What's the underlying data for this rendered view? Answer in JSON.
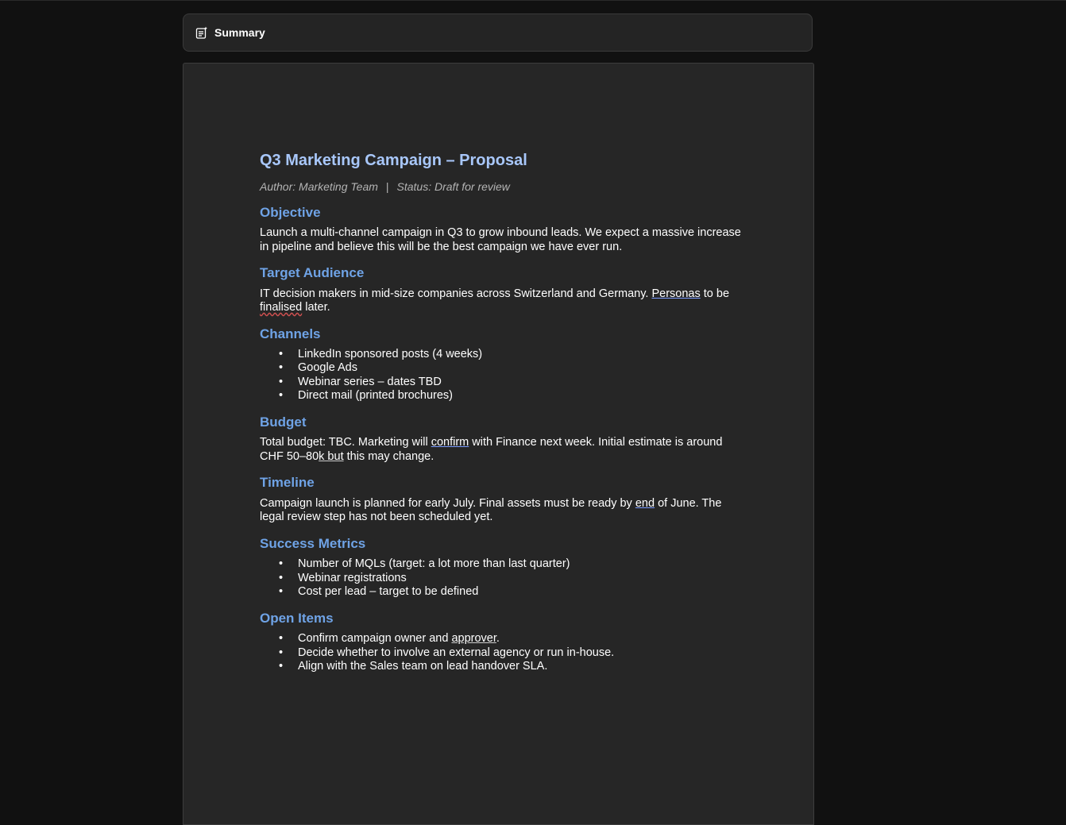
{
  "summary": {
    "label": "Summary",
    "icon": "summary-sparkle-icon"
  },
  "document": {
    "title": "Q3 Marketing Campaign – Proposal",
    "author": "Author: Marketing Team",
    "separator": "|",
    "status": "Status: Draft for review",
    "objective": {
      "heading": "Objective",
      "text": "Launch a multi-channel campaign in Q3 to grow inbound leads. We expect a massive increase in pipeline and believe this will be the best campaign we have ever run."
    },
    "target_audience": {
      "heading": "Target Audience",
      "text_before": "IT decision makers in mid-size companies across Switzerland and Germany. ",
      "personas": "Personas",
      "text_mid": " to be ",
      "finalised": "finalised",
      "text_after": " later."
    },
    "channels": {
      "heading": "Channels",
      "items": [
        "LinkedIn sponsored posts (4 weeks)",
        "Google Ads",
        "Webinar series – dates TBD",
        "Direct mail (printed brochures)"
      ]
    },
    "budget": {
      "heading": "Budget",
      "text_before": "Total budget: TBC. Marketing will ",
      "confirm": "confirm",
      "text_mid": " with Finance next week. Initial estimate is around CHF 50–80",
      "k_but": "k but",
      "text_after": " this may change."
    },
    "timeline": {
      "heading": "Timeline",
      "text_before": "Campaign launch is planned for early July. Final assets must be ready by ",
      "end": "end",
      "text_after": " of June. The legal review step has not been scheduled yet."
    },
    "success_metrics": {
      "heading": "Success Metrics",
      "items": [
        "Number of MQLs (target: a lot more than last quarter)",
        "Webinar registrations",
        "Cost per lead – target to be defined"
      ]
    },
    "open_items": {
      "heading": "Open Items",
      "item1_before": "Confirm campaign owner and ",
      "item1_approver": "approver",
      "item1_after": ".",
      "item2": "Decide whether to involve an external agency or run in-house.",
      "item3": "Align with the Sales team on lead handover SLA."
    },
    "bullet": "•"
  },
  "colors": {
    "background": "#111111",
    "page": "#262626",
    "title": "#a8c7fa",
    "heading": "#6fa3e6"
  }
}
